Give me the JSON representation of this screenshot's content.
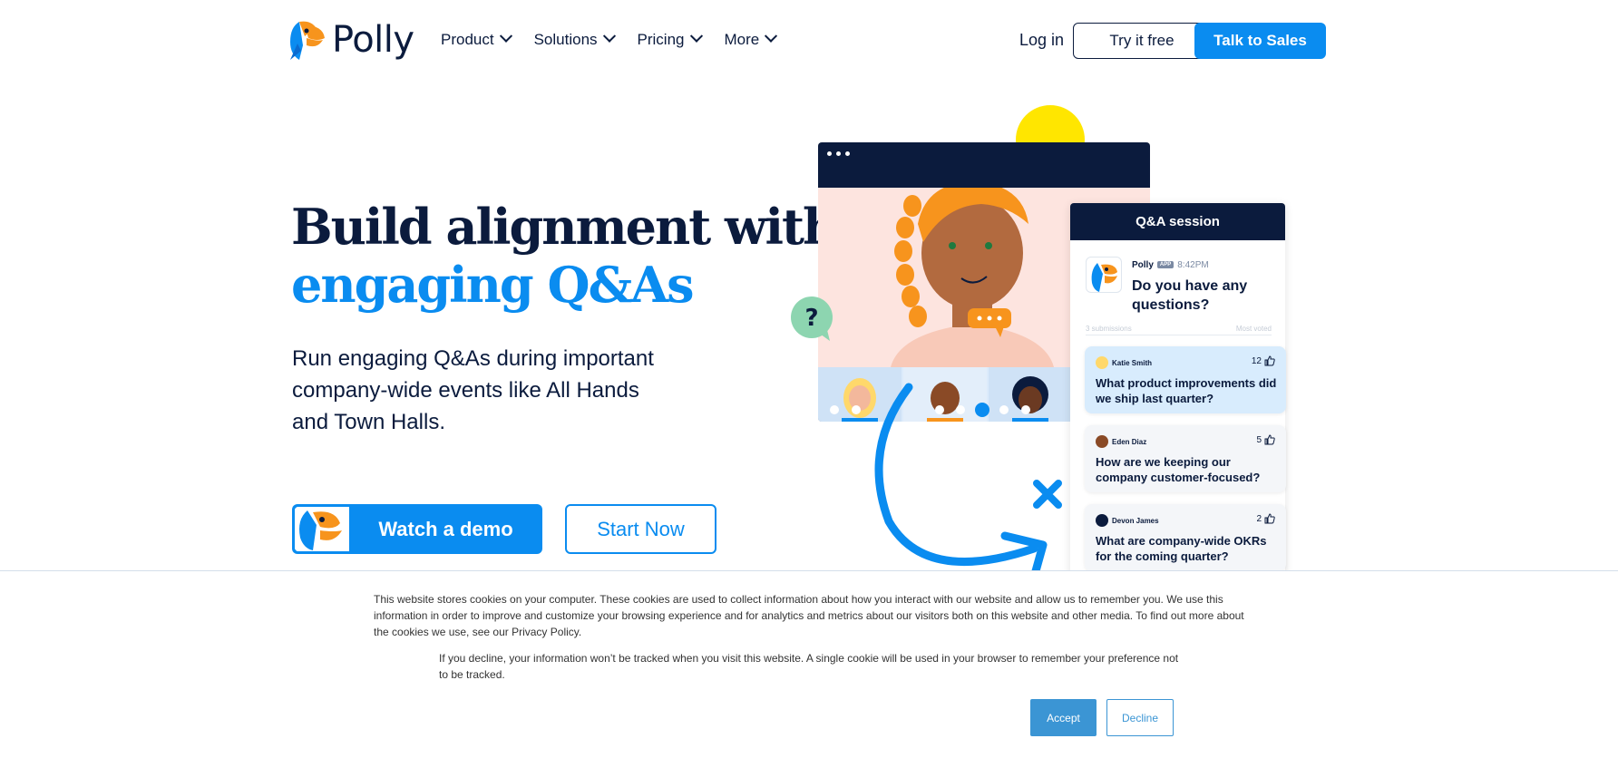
{
  "brand": {
    "name": "Polly",
    "accent": "#0a8cf0",
    "navy": "#0b1b3d",
    "orange": "#f7941d"
  },
  "nav": {
    "items": [
      {
        "label": "Product"
      },
      {
        "label": "Solutions"
      },
      {
        "label": "Pricing"
      },
      {
        "label": "More"
      }
    ],
    "login": "Log in",
    "try_free": "Try it free",
    "talk_sales": "Talk to Sales"
  },
  "hero": {
    "title_line1": "Build alignment with",
    "title_line2": "engaging Q&As",
    "subtitle": "Run engaging Q&As during important company-wide events like All Hands and Town Halls.",
    "cta_primary": "Watch a demo",
    "cta_secondary": "Start Now"
  },
  "illustration": {
    "qa_header": "Q&A session",
    "polly_name": "Polly",
    "app_badge": "APP",
    "polly_time": "8:42PM",
    "polly_question": "Do you have any questions?",
    "submissions": "3 submissions",
    "sort": "Most voted",
    "questions": [
      {
        "author": "Katie Smith",
        "votes": "12",
        "text": "What product improvements did we ship last quarter?"
      },
      {
        "author": "Eden Diaz",
        "votes": "5",
        "text": "How are we keeping our company customer-focused?"
      },
      {
        "author": "Devon James",
        "votes": "2",
        "text": "What are company-wide OKRs for the coming quarter?"
      }
    ]
  },
  "cookie": {
    "text1": "This website stores cookies on your computer. These cookies are used to collect information about how you interact with our website and allow us to remember you. We use this information in order to improve and customize your browsing experience and for analytics and metrics about our visitors both on this website and other media. To find out more about the cookies we use, see our Privacy Policy.",
    "text2": "If you decline, your information won’t be tracked when you visit this website. A single cookie will be used in your browser to remember your preference not to be tracked.",
    "accept": "Accept",
    "decline": "Decline"
  }
}
